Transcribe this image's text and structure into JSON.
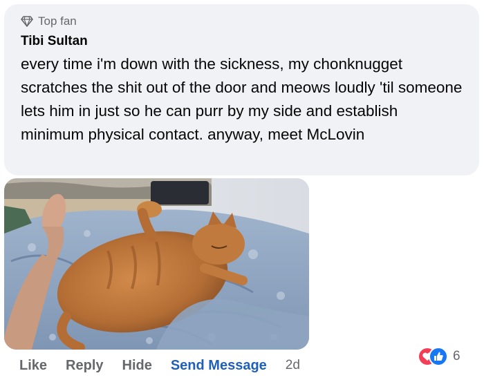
{
  "comment": {
    "badge": {
      "icon": "diamond-icon",
      "label": "Top fan"
    },
    "author": "Tibi Sultan",
    "text": "every time i'm down with the sickness, my chonknugget scratches the shit out of the door and meows loudly 'til someone lets him in just so he can purr by my side and establish minimum physical contact. anyway, meet McLovin",
    "photo": {
      "subject": "orange cat stretched on blue floral bedsheet"
    }
  },
  "actions": {
    "like": "Like",
    "reply": "Reply",
    "hide": "Hide",
    "send_message": "Send Message",
    "timestamp": "2d"
  },
  "reactions": {
    "icons": [
      "love-reaction-icon",
      "like-reaction-icon"
    ],
    "count": "6"
  },
  "colors": {
    "bubble": "#f0f2f5",
    "secondary_text": "#65676b",
    "link": "#1f5fb8",
    "love": "#f33e58",
    "like": "#1877f2"
  }
}
